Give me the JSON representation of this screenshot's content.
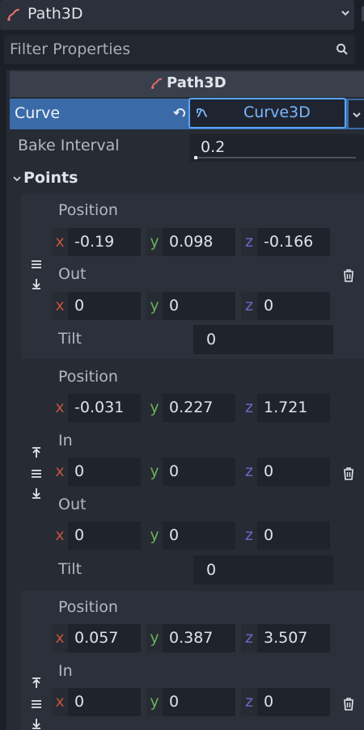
{
  "node_selector": {
    "label": "Path3D"
  },
  "filter": {
    "placeholder": "Filter Properties"
  },
  "inspector": {
    "section_title": "Path3D",
    "curve": {
      "label": "Curve",
      "resource": "Curve3D"
    },
    "bake_interval": {
      "label": "Bake Interval",
      "value": "0.2"
    },
    "points_label": "Points"
  },
  "axes": {
    "x": "x",
    "y": "y",
    "z": "z"
  },
  "labels": {
    "position": "Position",
    "in": "In",
    "out": "Out",
    "tilt": "Tilt"
  },
  "points": [
    {
      "position": {
        "x": "-0.19",
        "y": "0.098",
        "z": "-0.166"
      },
      "out": {
        "x": "0",
        "y": "0",
        "z": "0"
      },
      "tilt": "0"
    },
    {
      "position": {
        "x": "-0.031",
        "y": "0.227",
        "z": "1.721"
      },
      "in": {
        "x": "0",
        "y": "0",
        "z": "0"
      },
      "out": {
        "x": "0",
        "y": "0",
        "z": "0"
      },
      "tilt": "0"
    },
    {
      "position": {
        "x": "0.057",
        "y": "0.387",
        "z": "3.507"
      },
      "in": {
        "x": "0",
        "y": "0",
        "z": "0"
      }
    }
  ],
  "colors": {
    "accent": "#58a6ff",
    "selected_row": "#3a6aa8",
    "axis_x": "#c4533c",
    "axis_y": "#6bb05a",
    "axis_z": "#7664c9",
    "path_icon": "#e0706a"
  },
  "icons": {
    "path": "path3d-icon",
    "dropdown": "chevron-down-icon",
    "search": "search-icon",
    "revert": "revert-icon",
    "curve_resource": "curve3d-icon",
    "collapse": "collapse-arrow-icon",
    "drag": "drag-handle-icon",
    "move_up": "move-up-icon",
    "move_down": "move-down-icon",
    "delete": "trash-icon"
  }
}
